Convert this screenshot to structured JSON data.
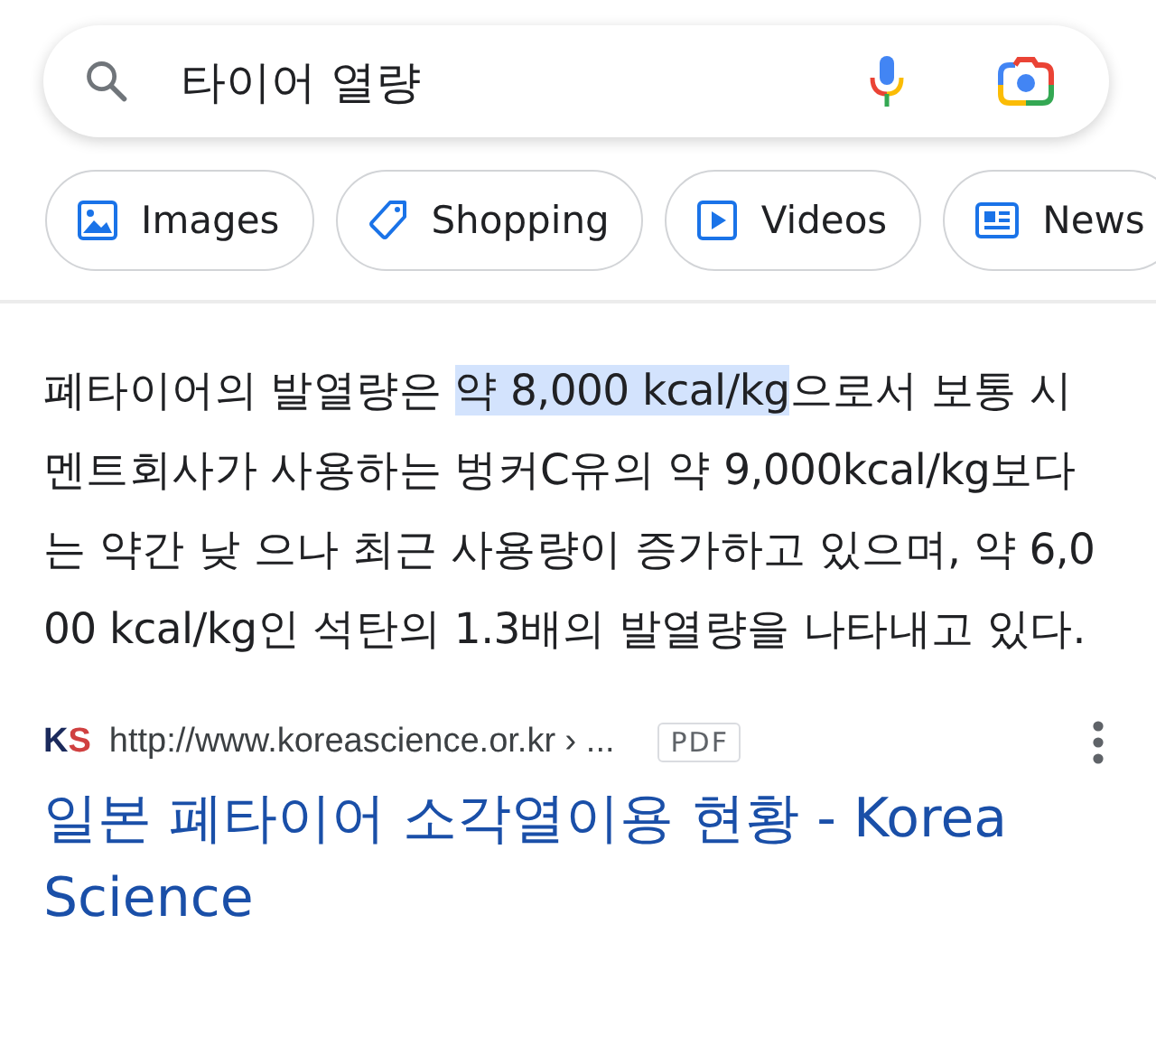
{
  "search": {
    "value": "타이어 열량"
  },
  "chips": [
    {
      "label": "Images",
      "kind": "images"
    },
    {
      "label": "Shopping",
      "kind": "shopping"
    },
    {
      "label": "Videos",
      "kind": "videos"
    },
    {
      "label": "News",
      "kind": "news"
    }
  ],
  "snippet": {
    "parts": [
      {
        "text": "폐타이어의 발열량은 ",
        "highlighted": false
      },
      {
        "text": "약 8,000 kcal/kg",
        "highlighted": true
      },
      {
        "text": "으로서 보통 시멘트회사가 사용하는 벙커C유의 약 9,000kcal/kg보다는 약간 낮 으나 최근 사용량이 증가하고 있으며, 약 6,000 kcal/kg인 석탄의 1.3배의 발열량을 나타내고 있다.",
        "highlighted": false
      }
    ]
  },
  "result": {
    "site_logo": "KS",
    "url": "http://www.koreascience.or.kr › ...",
    "badge": "PDF",
    "title": "일본 폐타이어 소각열이용 현황 - Korea Science"
  }
}
